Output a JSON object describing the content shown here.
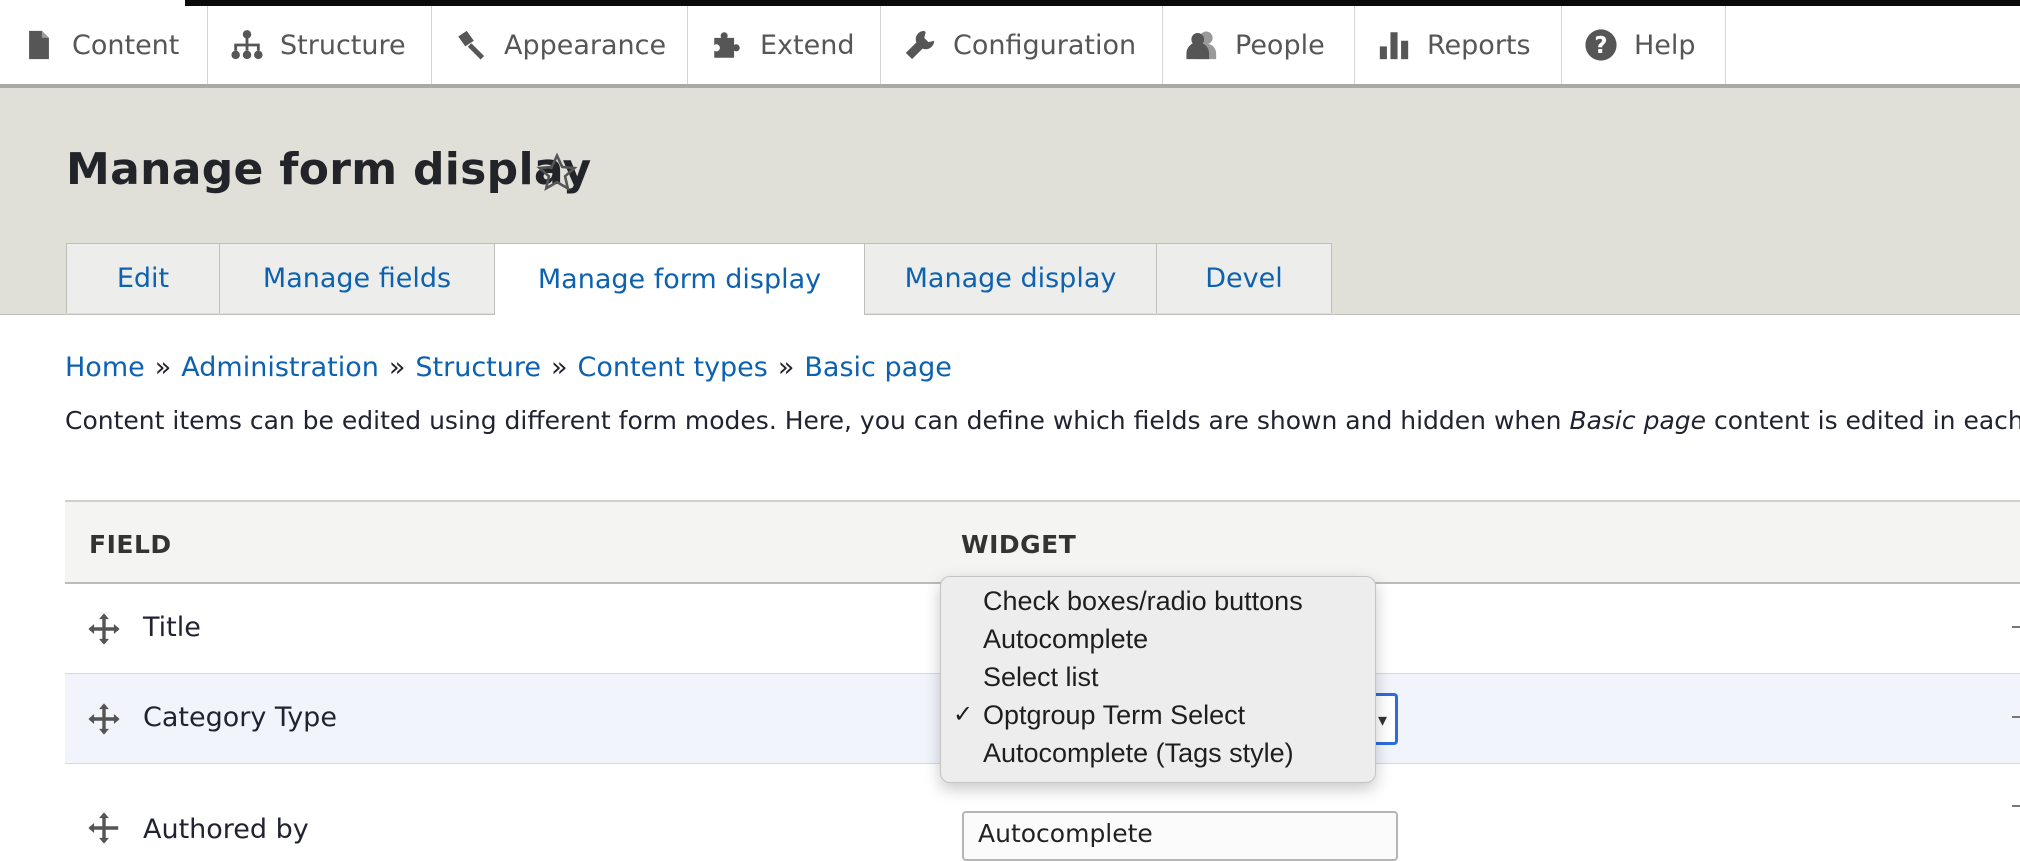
{
  "toolbar": {
    "items": [
      {
        "label": "Content",
        "icon": "file-icon"
      },
      {
        "label": "Structure",
        "icon": "sitemap-icon"
      },
      {
        "label": "Appearance",
        "icon": "paintbrush-icon"
      },
      {
        "label": "Extend",
        "icon": "puzzle-icon"
      },
      {
        "label": "Configuration",
        "icon": "wrench-icon"
      },
      {
        "label": "People",
        "icon": "people-icon"
      },
      {
        "label": "Reports",
        "icon": "bar-chart-icon"
      },
      {
        "label": "Help",
        "icon": "help-icon"
      }
    ]
  },
  "page": {
    "title": "Manage form display"
  },
  "tabs": [
    {
      "label": "Edit",
      "active": false
    },
    {
      "label": "Manage fields",
      "active": false
    },
    {
      "label": "Manage form display",
      "active": true
    },
    {
      "label": "Manage display",
      "active": false
    },
    {
      "label": "Devel",
      "active": false
    }
  ],
  "breadcrumb": {
    "items": [
      "Home",
      "Administration",
      "Structure",
      "Content types",
      "Basic page"
    ],
    "separator": "»"
  },
  "description": {
    "before": "Content items can be edited using different form modes. Here, you can define which fields are shown and hidden when ",
    "emphasis": "Basic page",
    "after": " content is edited in each"
  },
  "table": {
    "columns": [
      "FIELD",
      "WIDGET"
    ],
    "rows": [
      {
        "name": "Title"
      },
      {
        "name": "Category Type"
      },
      {
        "name": "Authored by"
      }
    ],
    "bottom_select_value": "Autocomplete"
  },
  "dropdown": {
    "options": [
      {
        "label": "Check boxes/radio buttons",
        "selected": false
      },
      {
        "label": "Autocomplete",
        "selected": false
      },
      {
        "label": "Select list",
        "selected": false
      },
      {
        "label": "Optgroup Term Select",
        "selected": true
      },
      {
        "label": "Autocomplete (Tags style)",
        "selected": false
      }
    ],
    "check_glyph": "✓"
  },
  "colors": {
    "link": "#0d62b0",
    "header_bg": "#e0e0d8",
    "focus": "#2d6bde"
  }
}
